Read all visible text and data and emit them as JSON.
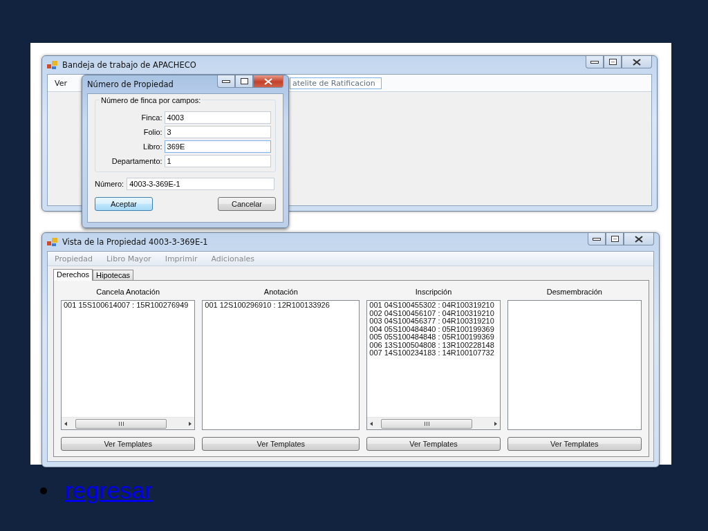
{
  "main_window": {
    "title": "Bandeja de trabajo de APACHECO",
    "menu": [
      {
        "label": "Ver"
      }
    ],
    "toolbar_item": "atelite de Ratificacion"
  },
  "dialog": {
    "title": "Número de Propiedad",
    "group_title": "Número de finca por campos:",
    "fields": [
      {
        "label": "Finca:",
        "value": "4003",
        "focused": false
      },
      {
        "label": "Folio:",
        "value": "3",
        "focused": false
      },
      {
        "label": "Libro:",
        "value": "369E",
        "focused": true
      },
      {
        "label": "Departamento:",
        "value": "1",
        "focused": false
      }
    ],
    "number": {
      "label": "Número:",
      "value": "4003-3-369E-1"
    },
    "buttons": [
      {
        "label": "Aceptar",
        "default": true
      },
      {
        "label": "Cancelar",
        "default": false
      }
    ]
  },
  "property_window": {
    "title": "Vista de la Propiedad 4003-3-369E-1",
    "menu": [
      {
        "label": "Propiedad",
        "disabled": true
      },
      {
        "label": "Libro Mayor",
        "disabled": true
      },
      {
        "label": "Imprimir",
        "disabled": true
      },
      {
        "label": "Adicionales",
        "disabled": true
      }
    ],
    "tabs": [
      {
        "label": "Derechos",
        "selected": true
      },
      {
        "label": "Hipotecas",
        "selected": false
      }
    ],
    "columns": [
      {
        "heading": "Cancela Anotación",
        "items": [
          "001 15S100614007 : 15R100276949"
        ],
        "scrollbar": true,
        "button": "Ver Templates"
      },
      {
        "heading": "Anotación",
        "items": [
          "001 12S100296910 : 12R100133926"
        ],
        "scrollbar": false,
        "button": "Ver Templates"
      },
      {
        "heading": "Inscripción",
        "items": [
          "001 04S100455302 : 04R100319210",
          "002 04S100456107 : 04R100319210",
          "003 04S100456377 : 04R100319210",
          "004 05S100484840 : 05R100199369",
          "005 05S100484848 : 05R100199369",
          "006 13S100504808 : 13R100228148",
          "007 14S100234183 : 14R100107732"
        ],
        "scrollbar": true,
        "button": "Ver Templates"
      },
      {
        "heading": "Desmembración",
        "scrollbar": false,
        "button": "Ver Templates"
      }
    ]
  },
  "slide": {
    "link": "regresar"
  }
}
